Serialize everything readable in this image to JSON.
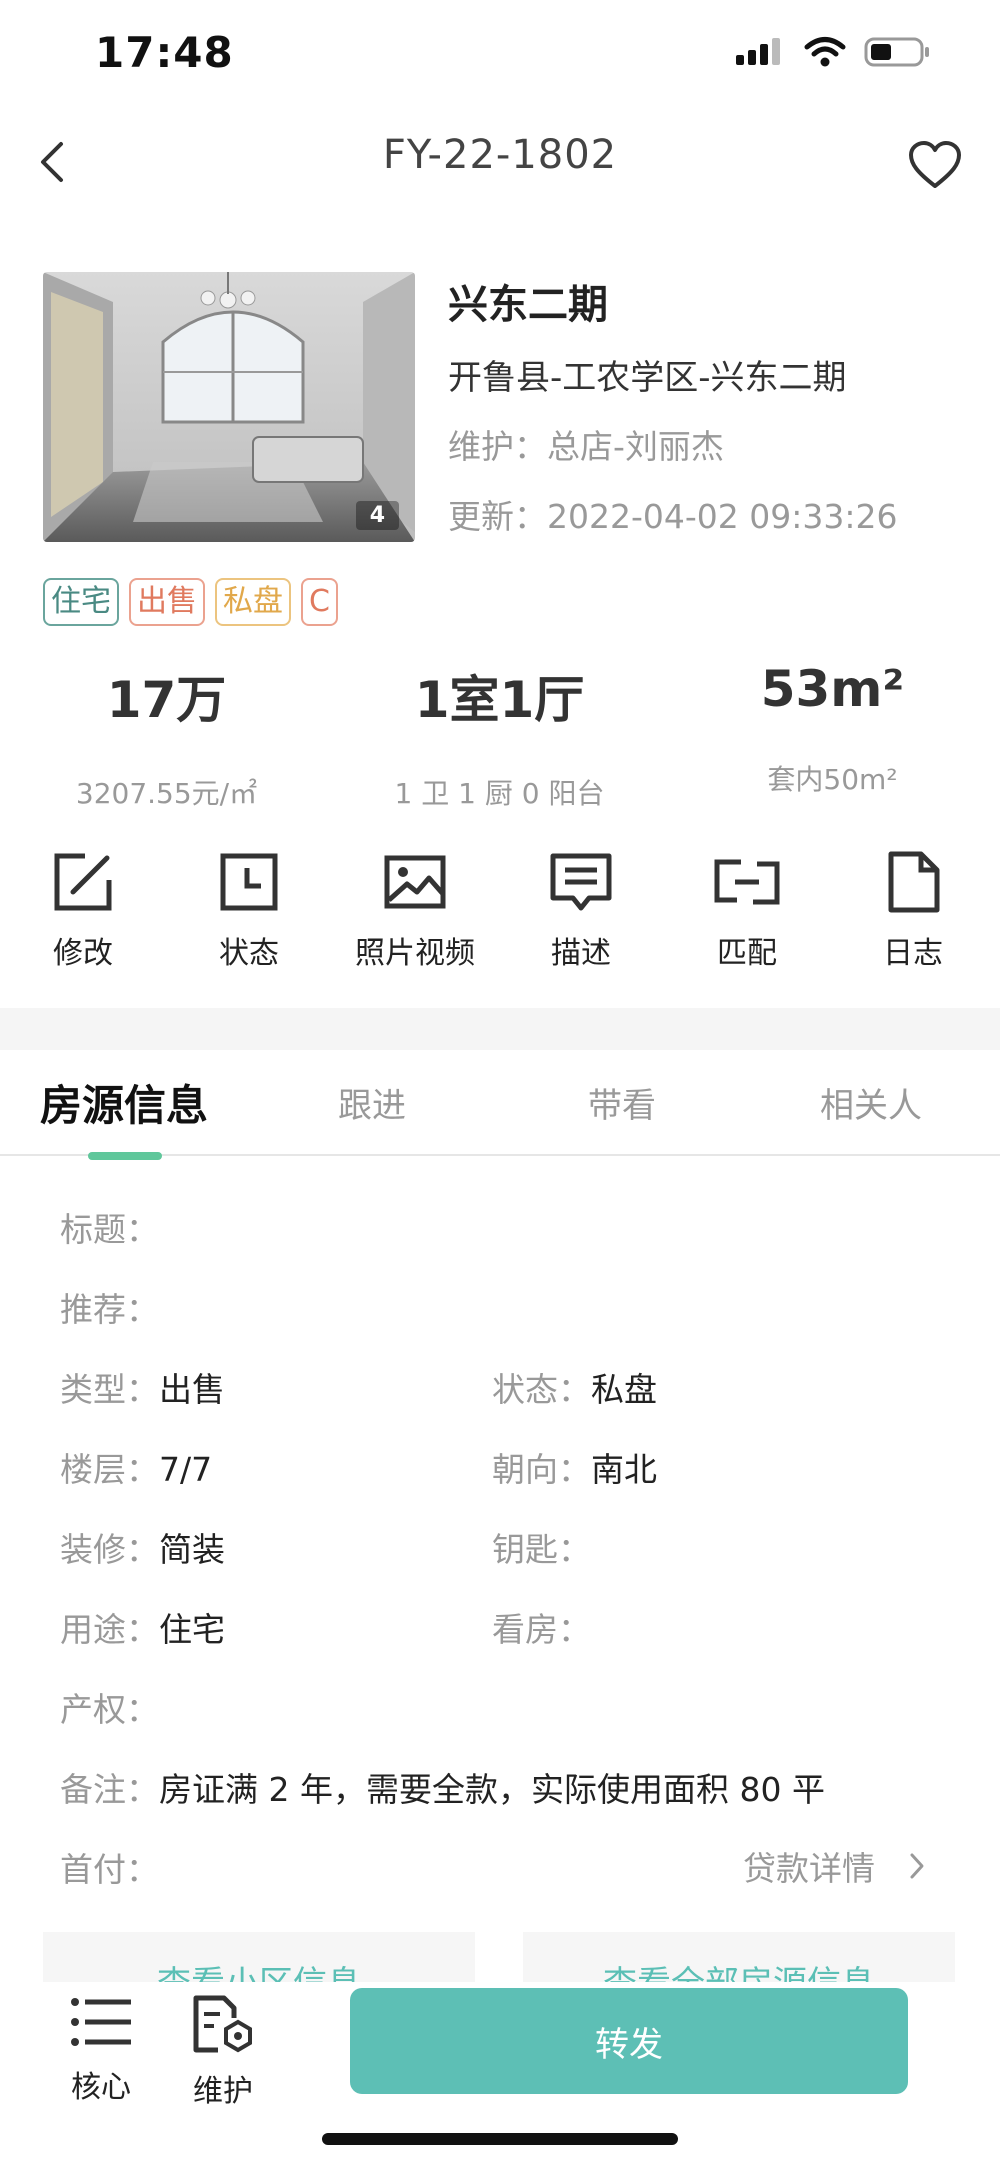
{
  "status_bar": {
    "time": "17:48"
  },
  "nav": {
    "title": "FY-22-1802"
  },
  "photo": {
    "count": "4"
  },
  "property": {
    "name": "兴东二期",
    "location": "开鲁县-工农学区-兴东二期",
    "maintainer_label": "维护：",
    "maintainer_value": "总店-刘丽杰",
    "updated_label": "更新：",
    "updated_value": "2022-04-02 09:33:26"
  },
  "tags": [
    "住宅",
    "出售",
    "私盘",
    "C"
  ],
  "stats": [
    {
      "main": "17万",
      "sub": "3207.55元/㎡"
    },
    {
      "main": "1室1厅",
      "sub": "1 卫 1 厨 0 阳台"
    },
    {
      "main": "53m²",
      "sub": "套内50m²"
    }
  ],
  "actions": [
    {
      "label": "修改",
      "icon": "edit-icon"
    },
    {
      "label": "状态",
      "icon": "status-icon"
    },
    {
      "label": "照片视频",
      "icon": "photo-icon"
    },
    {
      "label": "描述",
      "icon": "description-icon"
    },
    {
      "label": "匹配",
      "icon": "match-icon"
    },
    {
      "label": "日志",
      "icon": "log-icon"
    }
  ],
  "tabs": [
    "房源信息",
    "跟进",
    "带看",
    "相关人"
  ],
  "info": {
    "title_label": "标题：",
    "recommend_label": "推荐：",
    "type_label": "类型：",
    "type_value": "出售",
    "state_label": "状态：",
    "state_value": "私盘",
    "floor_label": "楼层：",
    "floor_value": "7/7",
    "orientation_label": "朝向：",
    "orientation_value": "南北",
    "decor_label": "装修：",
    "decor_value": "简装",
    "key_label": "钥匙：",
    "usage_label": "用途：",
    "usage_value": "住宅",
    "viewing_label": "看房：",
    "ownership_label": "产权：",
    "remark_label": "备注：",
    "remark_value": "房证满 2 年，需要全款，实际使用面积 80 平",
    "down_payment_label": "首付：",
    "loan_details": "贷款详情"
  },
  "peek_buttons": [
    "查看小区信息",
    "查看全部房源信息"
  ],
  "bottom_bar": {
    "core_label": "核心",
    "maintain_label": "维护",
    "forward_label": "转发"
  },
  "colors": {
    "accent": "#5dbfb5",
    "tab_underline": "#5fc79b"
  }
}
